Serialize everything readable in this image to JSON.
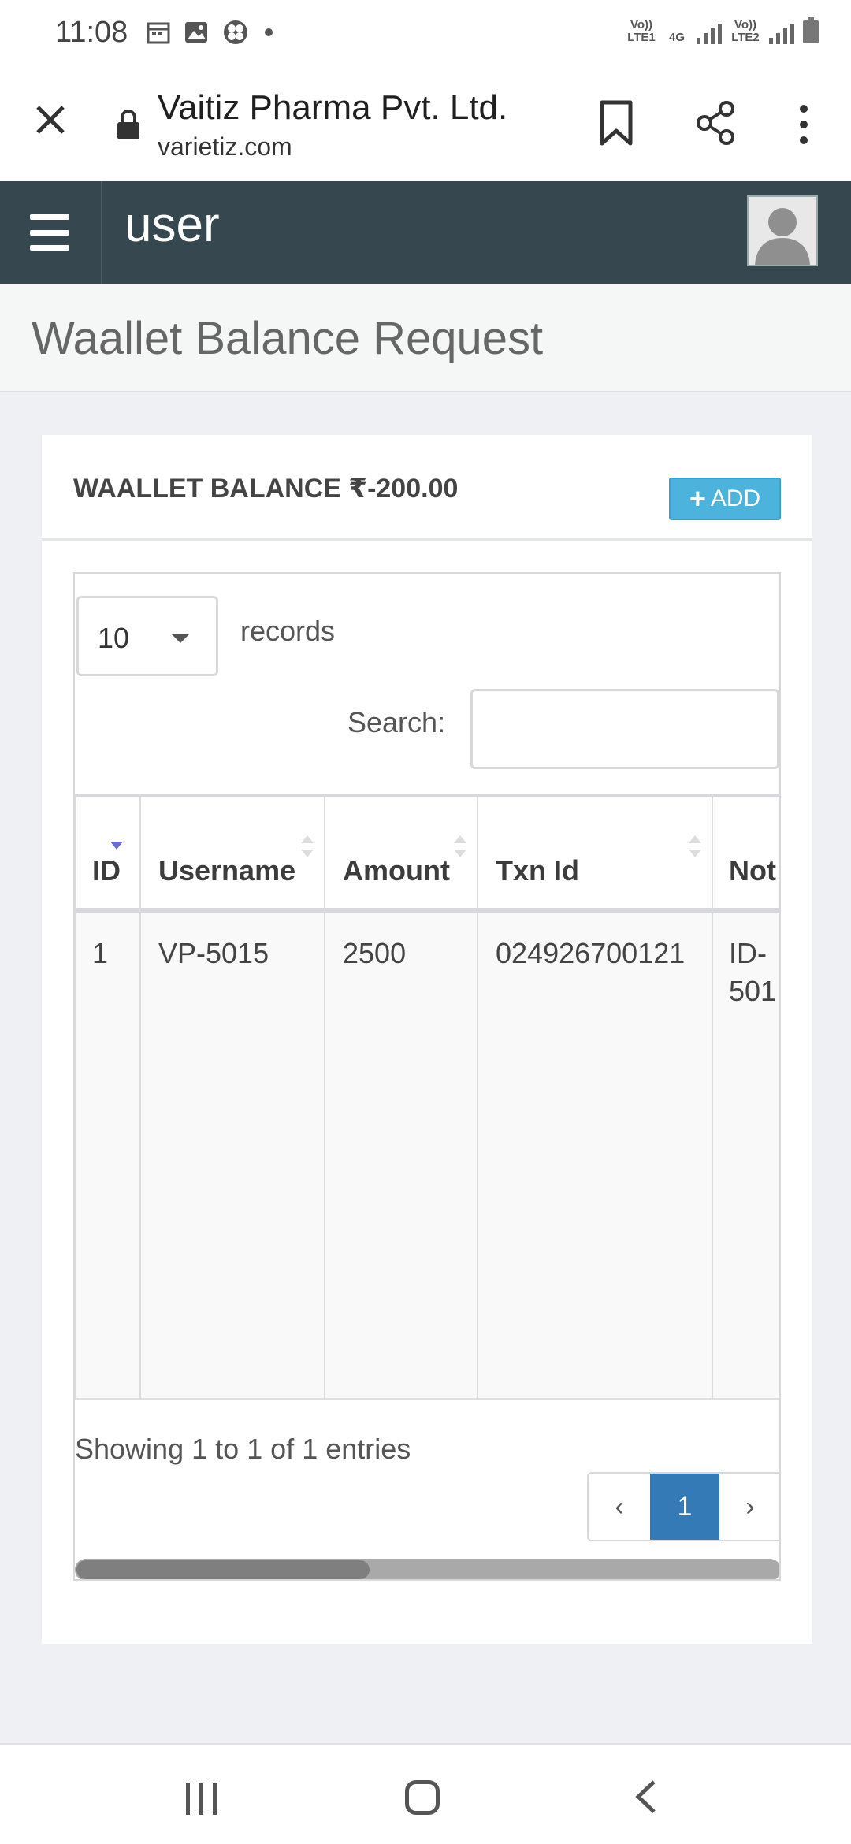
{
  "status_bar": {
    "time": "11:08",
    "sim1": "Vo)) LTE1",
    "net": "4G",
    "sim2": "Vo)) LTE2",
    "icons": [
      "calendar-icon",
      "image-icon",
      "app-icon",
      "dot-icon",
      "signal-icon",
      "battery-icon"
    ]
  },
  "browser": {
    "site_title": "Vaitiz Pharma Pvt. Ltd.",
    "url": "varietiz.com"
  },
  "app_header": {
    "section": "user"
  },
  "page": {
    "title": "Waallet Balance Request"
  },
  "card": {
    "balance_label": "WAALLET BALANCE ₹-200.00",
    "add_label": "ADD"
  },
  "table": {
    "length_value": "10",
    "records_label": "records",
    "search_label": "Search:",
    "search_value": "",
    "columns": [
      "ID",
      "Username",
      "Amount",
      "Txn Id",
      "Not"
    ],
    "rows": [
      {
        "id": "1",
        "username": "VP-5015",
        "amount": "2500",
        "txn_id": "024926700121",
        "note_line1": "ID-",
        "note_line2": "501"
      }
    ],
    "info": "Showing 1 to 1 of 1 entries",
    "pager": {
      "prev": "‹",
      "page": "1",
      "next": "›"
    }
  },
  "colors": {
    "header_bg": "#36474f",
    "add_button": "#4bb3dc",
    "pager_active": "#337ab7"
  }
}
